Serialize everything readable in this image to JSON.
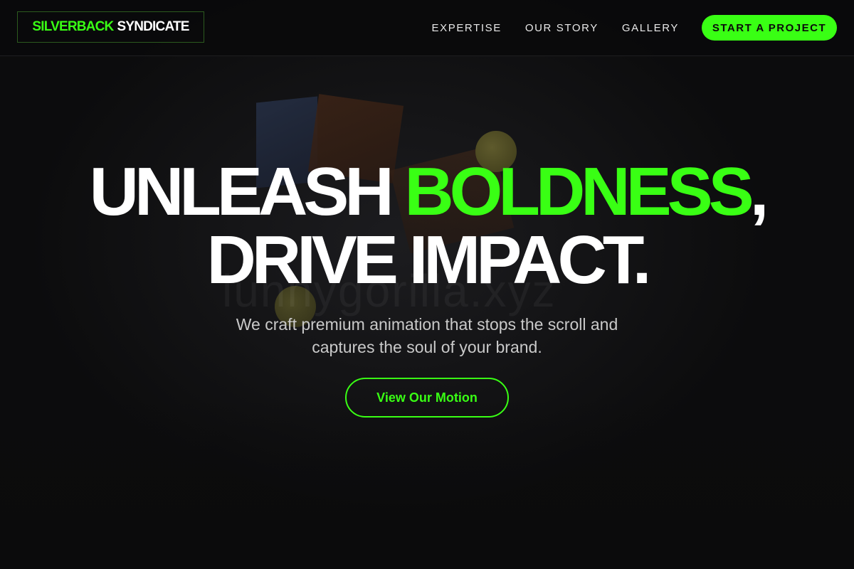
{
  "header": {
    "logo": {
      "accent_text": "SILVERBACK",
      "plain_text": "SYNDICATE"
    },
    "nav": [
      {
        "label": "EXPERTISE"
      },
      {
        "label": "OUR STORY"
      },
      {
        "label": "GALLERY"
      }
    ],
    "cta_label": "START A PROJECT"
  },
  "hero": {
    "title_line1_white": "UNLEASH",
    "title_line1_green": "BOLDNESS",
    "title_line1_comma": ",",
    "title_line2": "DRIVE IMPACT.",
    "subtitle_line1": "We craft premium animation that stops the scroll and",
    "subtitle_line2": "captures the soul of your brand.",
    "button_label": "View Our Motion",
    "background_watermark": "lunnygorilla.xyz"
  },
  "colors": {
    "accent": "#39ff14",
    "background": "#0c0c0d",
    "text": "#ffffff",
    "subtext": "#c9c9c9"
  }
}
